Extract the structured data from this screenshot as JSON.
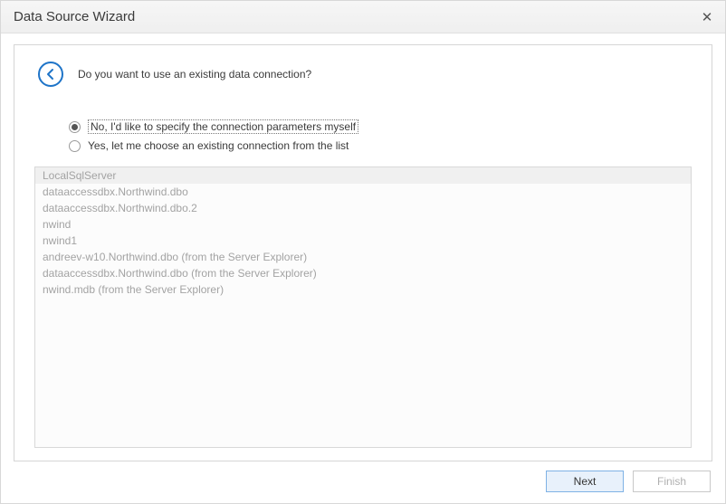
{
  "title": "Data Source Wizard",
  "question": "Do you want to use an existing data connection?",
  "radios": {
    "no": "No, I'd like to specify the connection parameters myself",
    "yes": "Yes, let me choose an existing connection from the list"
  },
  "connections": [
    "LocalSqlServer",
    "dataaccessdbx.Northwind.dbo",
    "dataaccessdbx.Northwind.dbo.2",
    "nwind",
    "nwind1",
    "andreev-w10.Northwind.dbo (from the Server Explorer)",
    "dataaccessdbx.Northwind.dbo (from the Server Explorer)",
    "nwind.mdb (from the Server Explorer)"
  ],
  "selected_connection_index": 0,
  "buttons": {
    "next": "Next",
    "finish": "Finish"
  }
}
